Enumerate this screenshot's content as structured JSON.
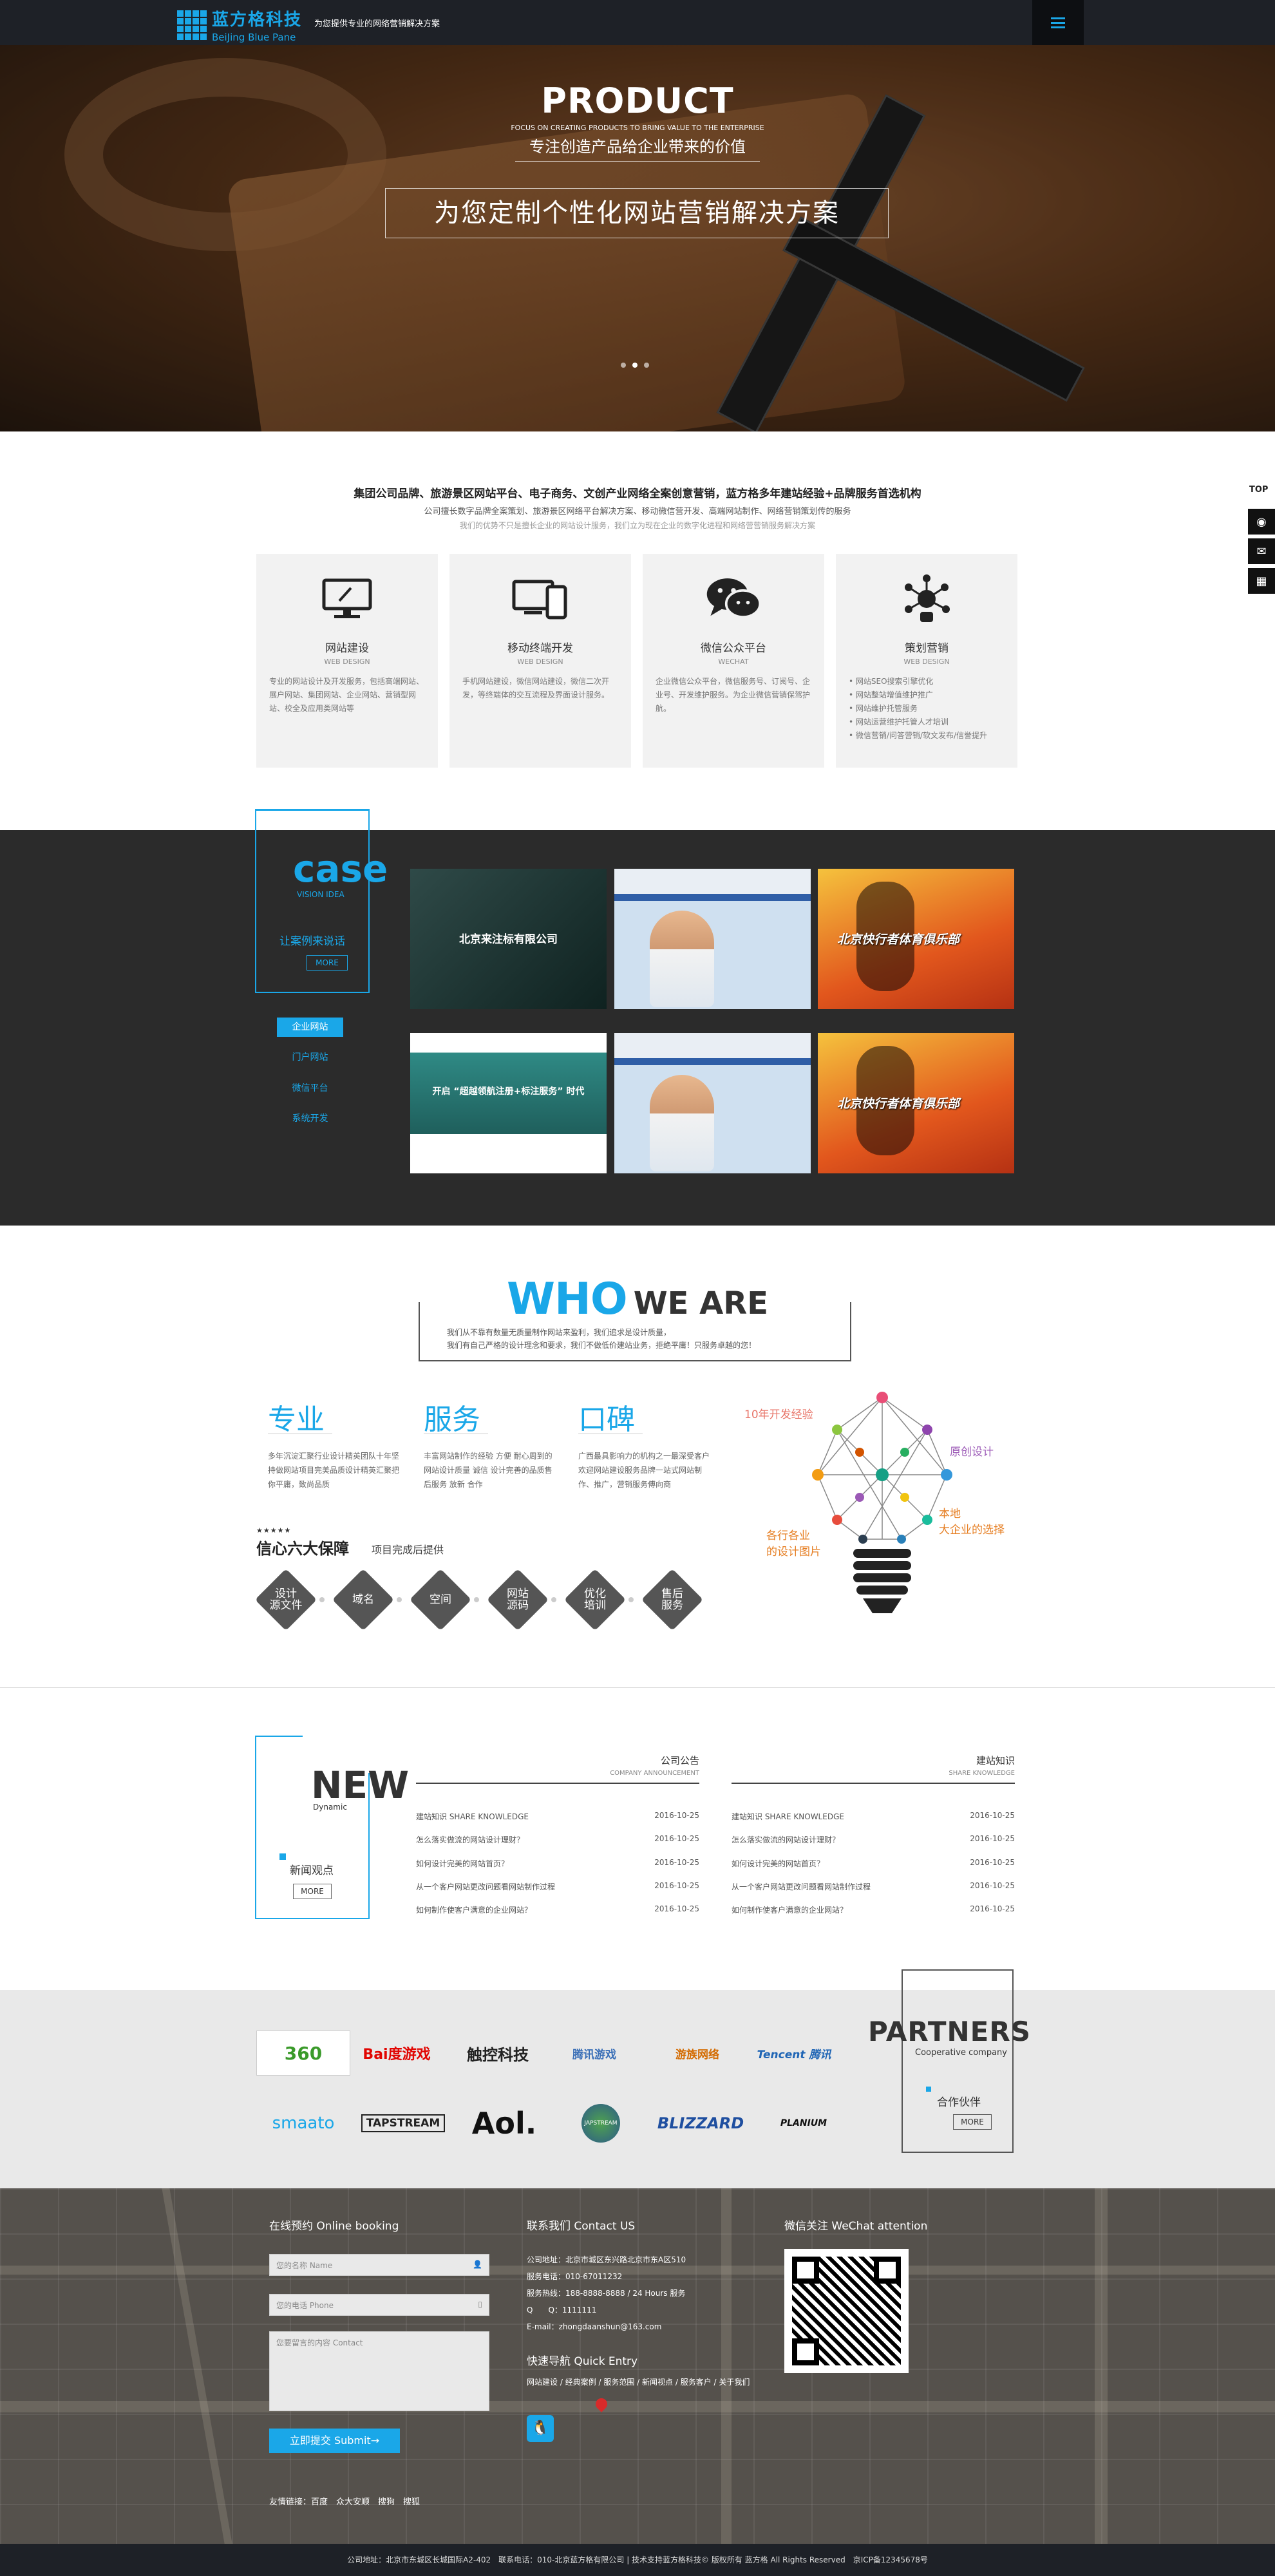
{
  "header": {
    "logo_cn": "蓝方格科技",
    "logo_en": "BeiJing Blue Pane",
    "slogan": "为您提供专业的网络营销解决方案",
    "menu_icon": "hamburger-icon"
  },
  "banner": {
    "title": "PRODUCT",
    "sub_en": "FOCUS ON CREATING PRODUCTS TO BRING VALUE TO THE ENTERPRISE",
    "sub_cn": "专注创造产品给企业带来的价值",
    "headline": "为您定制个性化网站营销解决方案",
    "slides": 3,
    "active_slide": 1
  },
  "side": {
    "top_label": "TOP",
    "icons": [
      "qq-icon",
      "chat-icon",
      "qrcode-icon"
    ]
  },
  "intro": {
    "heading": "集团公司品牌、旅游景区网站平台、电子商务、文创产业网络全案创意营销，蓝方格多年建站经验+品牌服务首选机构",
    "line1": "公司擅长数字品牌全案策划、旅游景区网络平台解决方案、移动微信营开发、高端网站制作、网络营销策划传的服务",
    "line2": "我们的优势不只是擅长企业的网站设计服务，我们立为现在企业的数字化进程和网络营营销服务解决方案"
  },
  "services": [
    {
      "icon": "monitor-icon",
      "title": "网站建设",
      "en": "WEB DESIGN",
      "desc": "专业的网站设计及开发服务，包括高端网站、展户网站、集团网站、企业网站、营销型网站、校全及应用类网站等"
    },
    {
      "icon": "mobile-icon",
      "title": "移动终端开发",
      "en": "WEB DESIGN",
      "desc": "手机网站建设，微信网站建设，微信二次开发，等终端体的交互流程及界面设计服务。"
    },
    {
      "icon": "wechat-icon",
      "title": "微信公众平台",
      "en": "WECHAT",
      "desc": "企业微信公众平台，微信服务号、订阅号、企业号、开发维护服务。为企业微信营销保驾护航。"
    },
    {
      "icon": "network-icon",
      "title": "策划营销",
      "en": "WEB DESIGN",
      "desc": "• 网站SEO搜索引擎优化\n• 网站整站增值维护推广\n• 网站维护托管服务\n• 网站运营维护托管人才培训\n• 微信营销/问答营销/软文发布/信誉提升"
    }
  ],
  "case": {
    "word": "case",
    "sub": "VISION IDEA",
    "link": "让案例来说话",
    "more": "MORE",
    "tabs": [
      "企业网站",
      "门户网站",
      "微信平台",
      "系统开发"
    ],
    "active_tab": 0,
    "thumbs": [
      {
        "style": "dark",
        "caption": "北京来注标有限公司"
      },
      {
        "style": "blue",
        "caption": ""
      },
      {
        "style": "run",
        "caption": "北京快行者体育俱乐部"
      },
      {
        "style": "green",
        "caption": "开启 “超越领航注册+标注服务” 时代"
      },
      {
        "style": "blue",
        "caption": ""
      },
      {
        "style": "run",
        "caption": "北京快行者体育俱乐部"
      }
    ]
  },
  "who": {
    "w1": "WHO",
    "w2": "WE ARE",
    "p1": "我们从不靠有数量无质量制作网站来盈利，我们追求是设计质量，",
    "p2": "我们有自己严格的设计理念和要求，我们不做低价建站业务，拒绝平庸！只服务卓越的您！",
    "features": [
      {
        "title": "专业",
        "desc": "多年沉淀汇聚行业设计精英团队十年坚持做网站项目完美品质设计精英汇聚把你平庸，致尚品质"
      },
      {
        "title": "服务",
        "desc": "丰富网站制作的经验 方便 耐心周到的网站设计质量 诚信 设计完善的品质售后服务 放新 合作"
      },
      {
        "title": "口碑",
        "desc": "广西最具影响力的机构之一最深受客户欢迎网站建设服务品牌一站式网站制作、推广，营销服务傅向商"
      }
    ],
    "stars": "★★★★★",
    "guarantee_h": "信心六大保障",
    "guarantee_s": "项目完成后提供",
    "diamonds": [
      "设计\n源文件",
      "域名",
      "空间",
      "网站\n源码",
      "优化\n培训",
      "售后\n服务"
    ],
    "bulb_labels": {
      "top": "10年开发经验",
      "right1": "原创设计",
      "right2": "本地\n大企业的选择",
      "left": "各行各业\n的设计图片"
    }
  },
  "news": {
    "word": "NEW",
    "sub": "Dynamic",
    "link": "新闻观点",
    "more": "MORE",
    "columns": [
      {
        "title": "公司公告",
        "en": "COMPANY ANNOUNCEMENT",
        "items": [
          {
            "t": "建站知识 SHARE KNOWLEDGE",
            "d": "2016-10-25"
          },
          {
            "t": "怎么落实做流的网站设计理财？",
            "d": "2016-10-25"
          },
          {
            "t": "如何设计完美的网站首页？",
            "d": "2016-10-25"
          },
          {
            "t": "从一个客户网站更改问题看网站制作过程",
            "d": "2016-10-25"
          },
          {
            "t": "如何制作使客户满意的企业网站？",
            "d": "2016-10-25"
          }
        ]
      },
      {
        "title": "建站知识",
        "en": "SHARE KNOWLEDGE",
        "items": [
          {
            "t": "建站知识 SHARE KNOWLEDGE",
            "d": "2016-10-25"
          },
          {
            "t": "怎么落实做流的网站设计理财？",
            "d": "2016-10-25"
          },
          {
            "t": "如何设计完美的网站首页？",
            "d": "2016-10-25"
          },
          {
            "t": "从一个客户网站更改问题看网站制作过程",
            "d": "2016-10-25"
          },
          {
            "t": "如何制作使客户满意的企业网站？",
            "d": "2016-10-25"
          }
        ]
      }
    ]
  },
  "partners": {
    "word": "PARTNERS",
    "sub": "Cooperative company",
    "link": "合作伙伴",
    "more": "MORE",
    "logos_row1": [
      "360",
      "Bai度游戏",
      "触控科技",
      "腾讯游戏",
      "游族网络",
      "Tencent 腾讯"
    ],
    "logos_row2": [
      "smaato",
      "TAPSTREAM",
      "Aol.",
      "JAPSTREAM",
      "BLIZZARD",
      "PLANIUM"
    ]
  },
  "footer": {
    "booking_h": "在线预约 Online booking",
    "name_ph": "您的名称 Name",
    "phone_ph": "您的电话 Phone",
    "msg_ph": "您要留言的内容 Contact",
    "submit": "立即提交 Submit→",
    "contact_h": "联系我们 Contact US",
    "contact_lines": [
      "公司地址：北京市城区东兴路北京市东A区510",
      "服务电话：010-67011232",
      "服务热线：188-8888-8888 / 24 Hours 服务",
      "Q　　Q：1111111",
      "E-mail：zhongdaanshun@163.com"
    ],
    "quick_h": "快速导航 Quick Entry",
    "quick_links": "网站建设 / 经典案例 / 服务范围 / 新闻视点 / 服务客户 / 关于我们",
    "wechat_h": "微信关注 WeChat attention",
    "friend_links": "友情链接：百度　众大安顺　搜狗　搜狐",
    "copyright": "公司地址：北京市东城区长城国际A2-402　联系电话：010-北京蓝方格有限公司 | 技术支持蓝方格科技© 版权所有 蓝方格 All Rights Reserved　京ICP备12345678号"
  }
}
